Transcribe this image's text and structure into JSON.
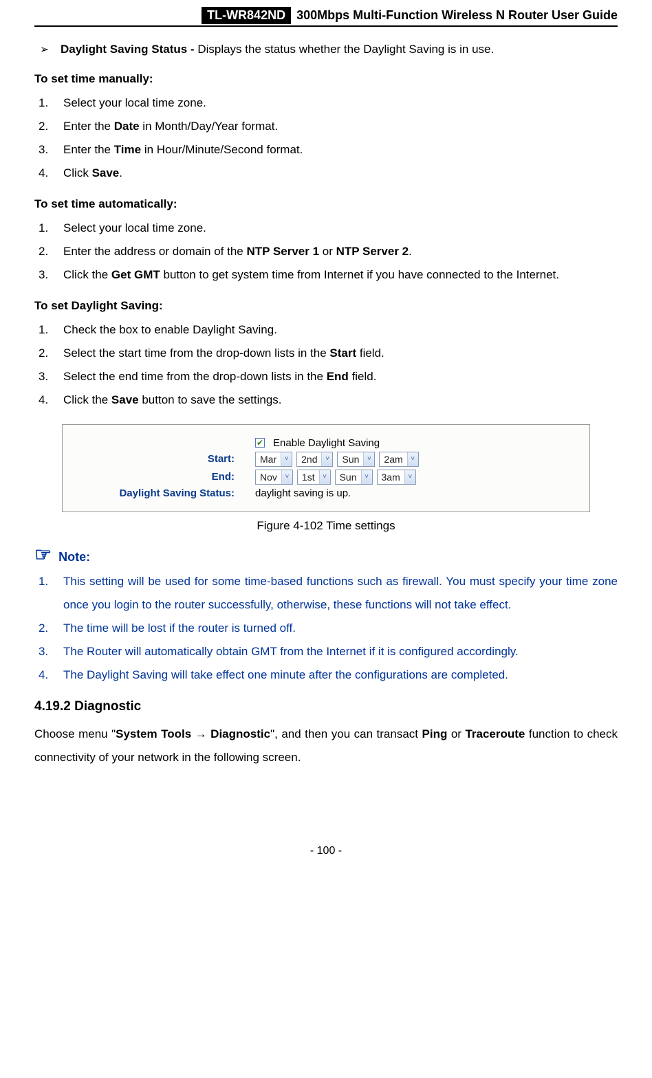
{
  "header": {
    "model": "TL-WR842ND",
    "title": "300Mbps Multi-Function Wireless N Router User Guide"
  },
  "dss_bullet": {
    "label": "Daylight Saving Status - ",
    "desc": "Displays the status whether the Daylight Saving is in use."
  },
  "sec_manual": {
    "title": "To set time manually:",
    "s1": "Select your local time zone.",
    "s2a": "Enter the ",
    "s2b": "Date",
    "s2c": " in Month/Day/Year format.",
    "s3a": "Enter the ",
    "s3b": "Time",
    "s3c": " in Hour/Minute/Second format.",
    "s4a": "Click ",
    "s4b": "Save",
    "s4c": "."
  },
  "sec_auto": {
    "title": "To set time automatically:",
    "s1": "Select your local time zone.",
    "s2a": "Enter the address or domain of the ",
    "s2b": "NTP Server 1",
    "s2c": " or ",
    "s2d": "NTP Server 2",
    "s2e": ".",
    "s3a": "Click the ",
    "s3b": "Get GMT",
    "s3c": " button to get system time from Internet if you have connected to the Internet."
  },
  "sec_ds": {
    "title": "To set Daylight Saving:",
    "s1": "Check the box to enable Daylight Saving.",
    "s2a": "Select the start time from the drop-down lists in the ",
    "s2b": "Start",
    "s2c": " field.",
    "s3a": "Select the end time from the drop-down lists in the ",
    "s3b": "End",
    "s3c": " field.",
    "s4a": "Click the ",
    "s4b": "Save",
    "s4c": " button to save the settings."
  },
  "figure": {
    "enable_label": "Enable Daylight Saving",
    "start_label": "Start:",
    "end_label": "End:",
    "dss_label": "Daylight Saving Status:",
    "start": {
      "month": "Mar",
      "ord": "2nd",
      "day": "Sun",
      "hour": "2am"
    },
    "end": {
      "month": "Nov",
      "ord": "1st",
      "day": "Sun",
      "hour": "3am"
    },
    "status_text": "daylight saving is up.",
    "caption": "Figure 4-102    Time settings"
  },
  "note": {
    "label": "Note:",
    "n1": "This setting will be used for some time-based functions such as firewall. You must specify your time zone once you login to the router successfully, otherwise, these functions will not take effect.",
    "n2": "The time will be lost if the router is turned off.",
    "n3": "The Router will automatically obtain GMT from the Internet if it is configured accordingly.",
    "n4": "The Daylight Saving will take effect one minute after the configurations are completed."
  },
  "diag": {
    "heading": "4.19.2  Diagnostic",
    "p1a": "Choose menu \"",
    "p1b": "System Tools",
    "p1c": " → ",
    "p1d": "Diagnostic",
    "p1e": "\", and then you can transact ",
    "p1f": "Ping",
    "p1g": " or ",
    "p1h": "Traceroute",
    "p1i": " function to check connectivity of your network in the following screen."
  },
  "footer": {
    "page": "- 100 -"
  }
}
